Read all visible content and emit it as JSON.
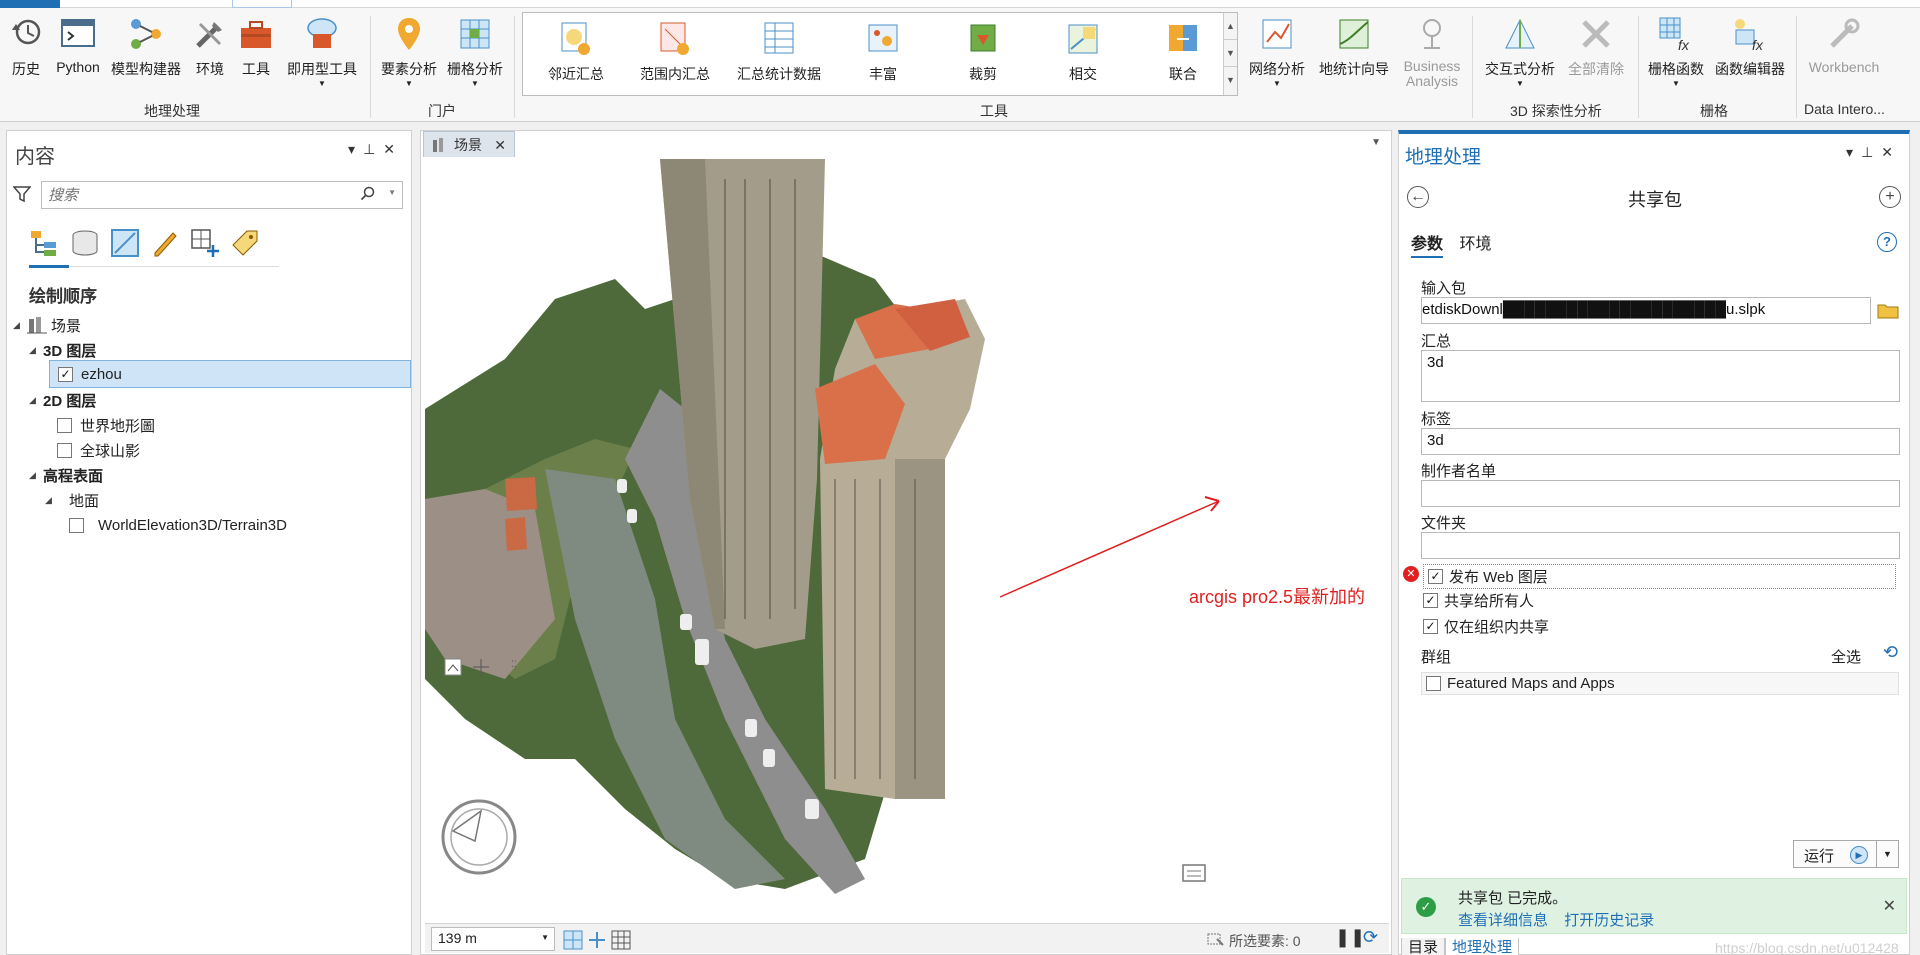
{
  "ribbon": {
    "geoprocessing": {
      "buttons": [
        {
          "label": "历史",
          "icon": "history-icon"
        },
        {
          "label": "Python",
          "icon": "python-icon"
        },
        {
          "label": "模型构建器",
          "icon": "modelbuilder-icon"
        },
        {
          "label": "环境",
          "icon": "environments-icon"
        },
        {
          "label": "工具",
          "icon": "toolbox-icon"
        },
        {
          "label": "即用型工具",
          "icon": "ready-to-use-icon"
        }
      ],
      "group": "地理处理"
    },
    "portal": {
      "buttons": [
        {
          "label": "要素分析",
          "icon": "feature-analysis-icon"
        },
        {
          "label": "栅格分析",
          "icon": "raster-analysis-icon"
        }
      ],
      "group": "门户"
    },
    "tools": {
      "gallery": [
        {
          "label": "邻近汇总",
          "icon": "summarize-nearby-icon"
        },
        {
          "label": "范围内汇总",
          "icon": "summarize-within-icon"
        },
        {
          "label": "汇总统计数据",
          "icon": "summary-statistics-icon"
        },
        {
          "label": "丰富",
          "icon": "enrich-icon"
        },
        {
          "label": "裁剪",
          "icon": "clip-icon"
        },
        {
          "label": "相交",
          "icon": "intersect-icon"
        },
        {
          "label": "联合",
          "icon": "union-icon"
        }
      ],
      "extra": [
        {
          "label": "网络分析",
          "icon": "network-analysis-icon"
        },
        {
          "label": "地统计向导",
          "icon": "geostat-wizard-icon"
        },
        {
          "label": "Business Analysis",
          "icon": "business-analysis-icon",
          "disabled": true
        }
      ],
      "group": "工具"
    },
    "exploratory": {
      "buttons": [
        {
          "label": "交互式分析",
          "icon": "interactive-analysis-icon"
        },
        {
          "label": "全部清除",
          "icon": "clear-all-icon",
          "disabled": true
        }
      ],
      "group": "3D 探索性分析"
    },
    "raster": {
      "buttons": [
        {
          "label": "栅格函数",
          "icon": "raster-functions-icon"
        },
        {
          "label": "函数编辑器",
          "icon": "function-editor-icon"
        }
      ],
      "group": "栅格"
    },
    "interop": {
      "buttons": [
        {
          "label": "Workbench",
          "icon": "workbench-icon",
          "disabled": true
        }
      ],
      "group": "Data Intero..."
    }
  },
  "contents": {
    "title": "内容",
    "search_placeholder": "搜索",
    "heading": "绘制顺序",
    "tree": {
      "scene": "场景",
      "layers3d": "3D 图层",
      "ezhou": "ezhou",
      "layers2d": "2D 图层",
      "topo": "世界地形圖",
      "hillshade": "全球山影",
      "elevation": "高程表面",
      "ground": "地面",
      "terrain": "WorldElevation3D/Terrain3D"
    },
    "checks": {
      "ezhou": true,
      "topo": false,
      "hillshade": false,
      "terrain": false
    }
  },
  "view": {
    "tab": "场景",
    "scale": "139 m",
    "selected_features": "所选要素: 0",
    "annotation": "arcgis pro2.5最新加的"
  },
  "geoprocessing": {
    "pane_title": "地理处理",
    "tool": "共享包",
    "tabs": {
      "params": "参数",
      "env": "环境"
    },
    "fields": {
      "input_package_label": "输入包",
      "input_package_value": "etdiskDownl█████████████████████u.slpk",
      "summary_label": "汇总",
      "summary_value": "3d",
      "tags_label": "标签",
      "tags_value": "3d",
      "credits_label": "制作者名单",
      "credits_value": "",
      "folder_label": "文件夹",
      "folder_value": ""
    },
    "checkboxes": {
      "publish_web_layer": "发布 Web 图层",
      "share_everyone": "共享给所有人",
      "share_org": "仅在组织内共享"
    },
    "groups_label": "群组",
    "select_all": "全选",
    "group_item": "Featured Maps and Apps",
    "run": "运行",
    "message": {
      "text": "共享包 已完成。",
      "details": "查看详细信息",
      "history": "打开历史记录"
    },
    "bottom_tabs": {
      "catalog": "目录",
      "gp": "地理处理"
    },
    "watermark": "https://blog.csdn.net/u012428"
  }
}
